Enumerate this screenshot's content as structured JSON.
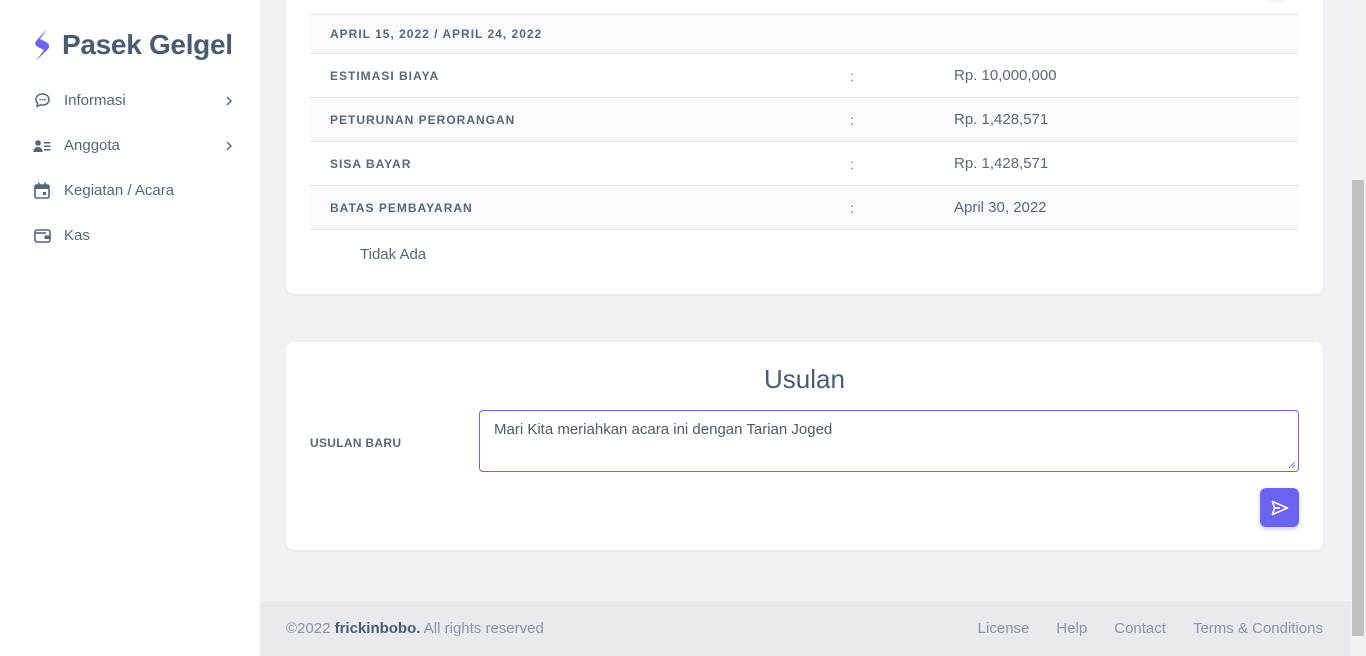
{
  "brand": {
    "name": "Pasek Gelgel",
    "icon": "s-logo-icon",
    "color": "#6c63f0"
  },
  "sidebar": {
    "items": [
      {
        "label": "Informasi",
        "icon": "chat-bubble-icon",
        "has_chevron": true
      },
      {
        "label": "Anggota",
        "icon": "users-list-icon",
        "has_chevron": true
      },
      {
        "label": "Kegiatan / Acara",
        "icon": "calendar-icon",
        "has_chevron": false
      },
      {
        "label": "Kas",
        "icon": "wallet-icon",
        "has_chevron": false
      }
    ]
  },
  "detail": {
    "date_range": "APRIL 15, 2022 / APRIL 24, 2022",
    "rows": [
      {
        "label": "ESTIMASI BIAYA",
        "colon": ":",
        "value": "Rp. 10,000,000"
      },
      {
        "label": "PETURUNAN PERORANGAN",
        "colon": ":",
        "value": "Rp. 1,428,571"
      },
      {
        "label": "SISA BAYAR",
        "colon": ":",
        "value": "Rp. 1,428,571"
      },
      {
        "label": "BATAS PEMBAYARAN",
        "colon": ":",
        "value": "April 30, 2022"
      }
    ],
    "empty_text": "Tidak Ada"
  },
  "usulan": {
    "title": "Usulan",
    "field_label": "USULAN BARU",
    "value": "Mari Kita meriahkan acara ini dengan Tarian Joged",
    "send_icon": "send-icon"
  },
  "footer": {
    "copyright_prefix": "©2022",
    "author": "frickinbobo.",
    "rights": "All rights reserved",
    "links": [
      "License",
      "Help",
      "Contact",
      "Terms & Conditions"
    ]
  }
}
